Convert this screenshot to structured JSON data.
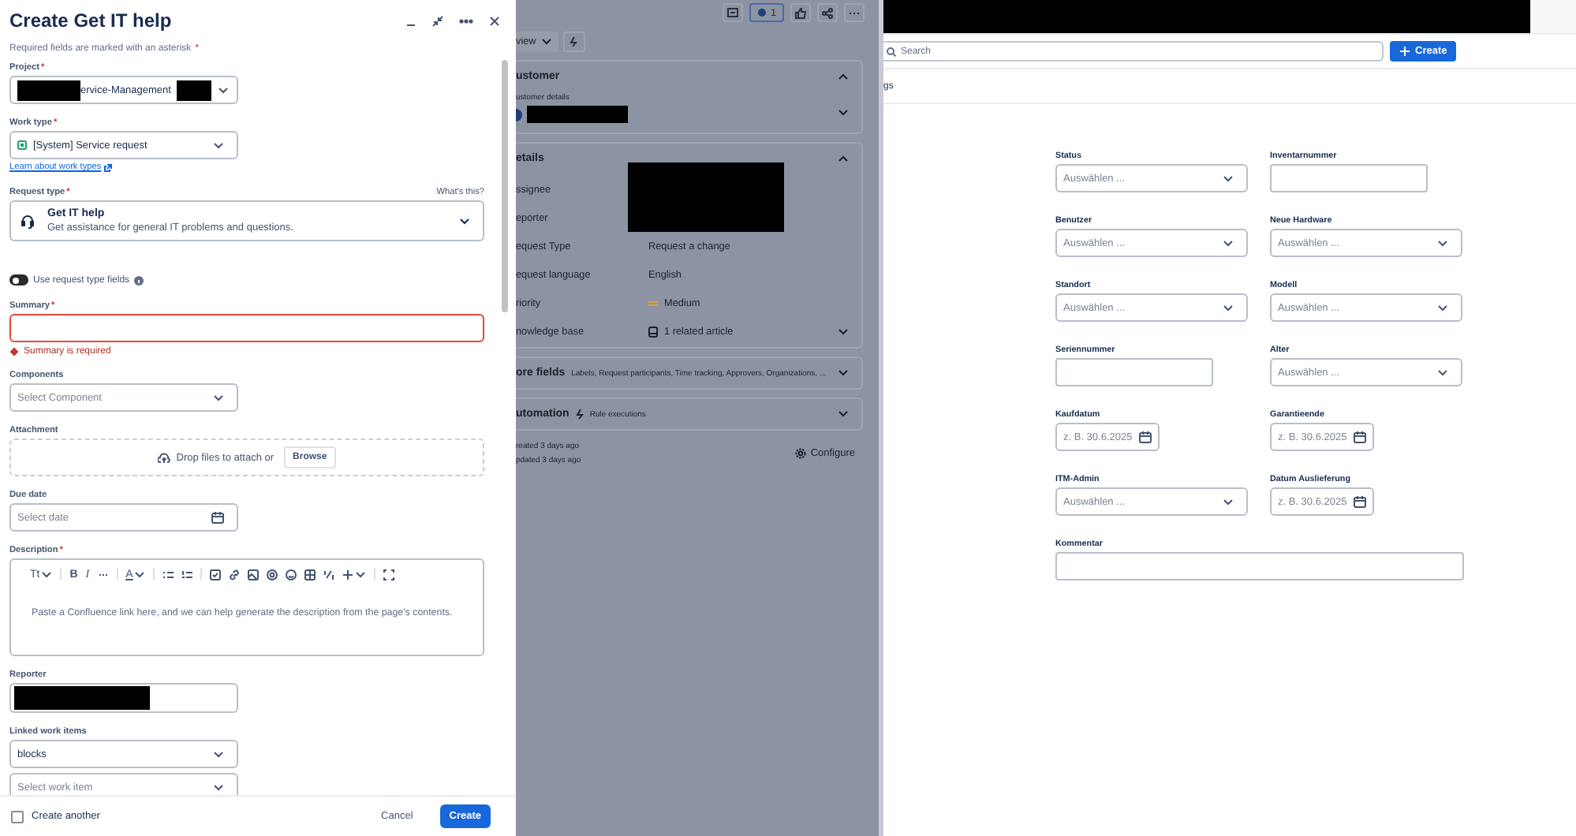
{
  "dialog": {
    "title": "Create Get IT help",
    "note": "Required fields are marked with an asterisk",
    "note_mark": "*",
    "fields": [
      {
        "kind": "project",
        "label": "Project",
        "mark": "*",
        "value": "ervice-Management"
      },
      {
        "kind": "work_type",
        "label": "Work type",
        "mark": "*",
        "value": "[System] Service request"
      },
      {
        "kind": "link",
        "text": "Learn about work types"
      },
      {
        "kind": "request_type",
        "label": "Request type",
        "mark": "*",
        "help": "What's this?",
        "title": "Get IT help",
        "description": "Get assistance for general IT problems and questions."
      },
      {
        "kind": "toggle",
        "label": "Use request type fields",
        "on": false
      },
      {
        "kind": "text",
        "label": "Summary",
        "mark": "*",
        "error": "Summary is required"
      },
      {
        "kind": "select",
        "label": "Components",
        "placeholder": "Select Component"
      },
      {
        "kind": "attachment",
        "label": "Attachment",
        "text": "Drop files to attach or",
        "button": "Browse"
      },
      {
        "kind": "date",
        "label": "Due date",
        "placeholder": "Select date"
      },
      {
        "kind": "editor",
        "label": "Description",
        "mark": "*",
        "toolbar": [
          {
            "kind": "text_style",
            "label": "Tt"
          },
          {
            "kind": "bold",
            "label": "B"
          },
          {
            "kind": "italic",
            "label": "I"
          },
          {
            "kind": "more"
          },
          {
            "kind": "color",
            "label": "A"
          },
          {
            "kind": "bullets"
          },
          {
            "kind": "numbers"
          },
          {
            "kind": "task"
          },
          {
            "kind": "link"
          },
          {
            "kind": "image"
          },
          {
            "kind": "mention"
          },
          {
            "kind": "emoji"
          },
          {
            "kind": "table"
          },
          {
            "kind": "layout"
          },
          {
            "kind": "insert"
          },
          {
            "kind": "expand"
          }
        ],
        "placeholder": "Paste a Confluence link here, and we can help generate the description from the page's contents."
      },
      {
        "kind": "reporter",
        "label": "Reporter"
      },
      {
        "kind": "select",
        "label": "Linked work items",
        "value": "blocks"
      },
      {
        "kind": "select",
        "placeholder": "Select work item"
      }
    ],
    "footer": {
      "checkbox_label": "Create another",
      "checked": false,
      "cancel": "Cancel",
      "submit": "Create"
    }
  },
  "issue": {
    "watchers": "1",
    "view_button": "view",
    "customer": {
      "title": "ustomer",
      "details_label": "ustomer details"
    },
    "details": {
      "title": "etails",
      "rows": [
        {
          "label": "ssignee"
        },
        {
          "label": "eporter"
        },
        {
          "label": "equest Type",
          "value": "Request a change",
          "kind": "form"
        },
        {
          "label": "equest language",
          "value": "English"
        },
        {
          "label": "riority",
          "value": "Medium",
          "kind": "priority"
        },
        {
          "label": "nowledge base",
          "value": "1 related article",
          "kind": "book",
          "expandable": true
        }
      ]
    },
    "more_fields": {
      "title": "ore fields",
      "summary": "Labels, Request participants, Time tracking, Approvers, Organizations, ..."
    },
    "automation": {
      "title": "utomation",
      "summary": "Rule executions"
    },
    "created": "reated 3 days ago",
    "updated": "pdated 3 days ago",
    "configure": "Configure"
  },
  "asset": {
    "search_placeholder": "Search",
    "create_button": "Create",
    "tab": "gs",
    "fields": [
      {
        "kind": "select",
        "label": "Status",
        "placeholder": "Auswählen ..."
      },
      {
        "kind": "text",
        "label": "Inventarnummer"
      },
      {
        "kind": "select",
        "label": "Benutzer",
        "placeholder": "Auswählen ..."
      },
      {
        "kind": "select",
        "label": "Neue Hardware",
        "placeholder": "Auswählen ..."
      },
      {
        "kind": "select",
        "label": "Standort",
        "placeholder": "Auswählen ..."
      },
      {
        "kind": "select",
        "label": "Modell",
        "placeholder": "Auswählen ..."
      },
      {
        "kind": "text",
        "label": "Seriennummer"
      },
      {
        "kind": "select",
        "label": "Alter",
        "placeholder": "Auswählen ..."
      },
      {
        "kind": "date",
        "label": "Kaufdatum",
        "placeholder": "z. B. 30.6.2025"
      },
      {
        "kind": "date",
        "label": "Garantieende",
        "placeholder": "z. B. 30.6.2025"
      },
      {
        "kind": "select",
        "label": "ITM-Admin",
        "placeholder": "Auswählen ..."
      },
      {
        "kind": "date",
        "label": "Datum Auslieferung",
        "placeholder": "z. B. 30.6.2025"
      },
      {
        "kind": "wide_text",
        "label": "Kommentar"
      }
    ]
  }
}
